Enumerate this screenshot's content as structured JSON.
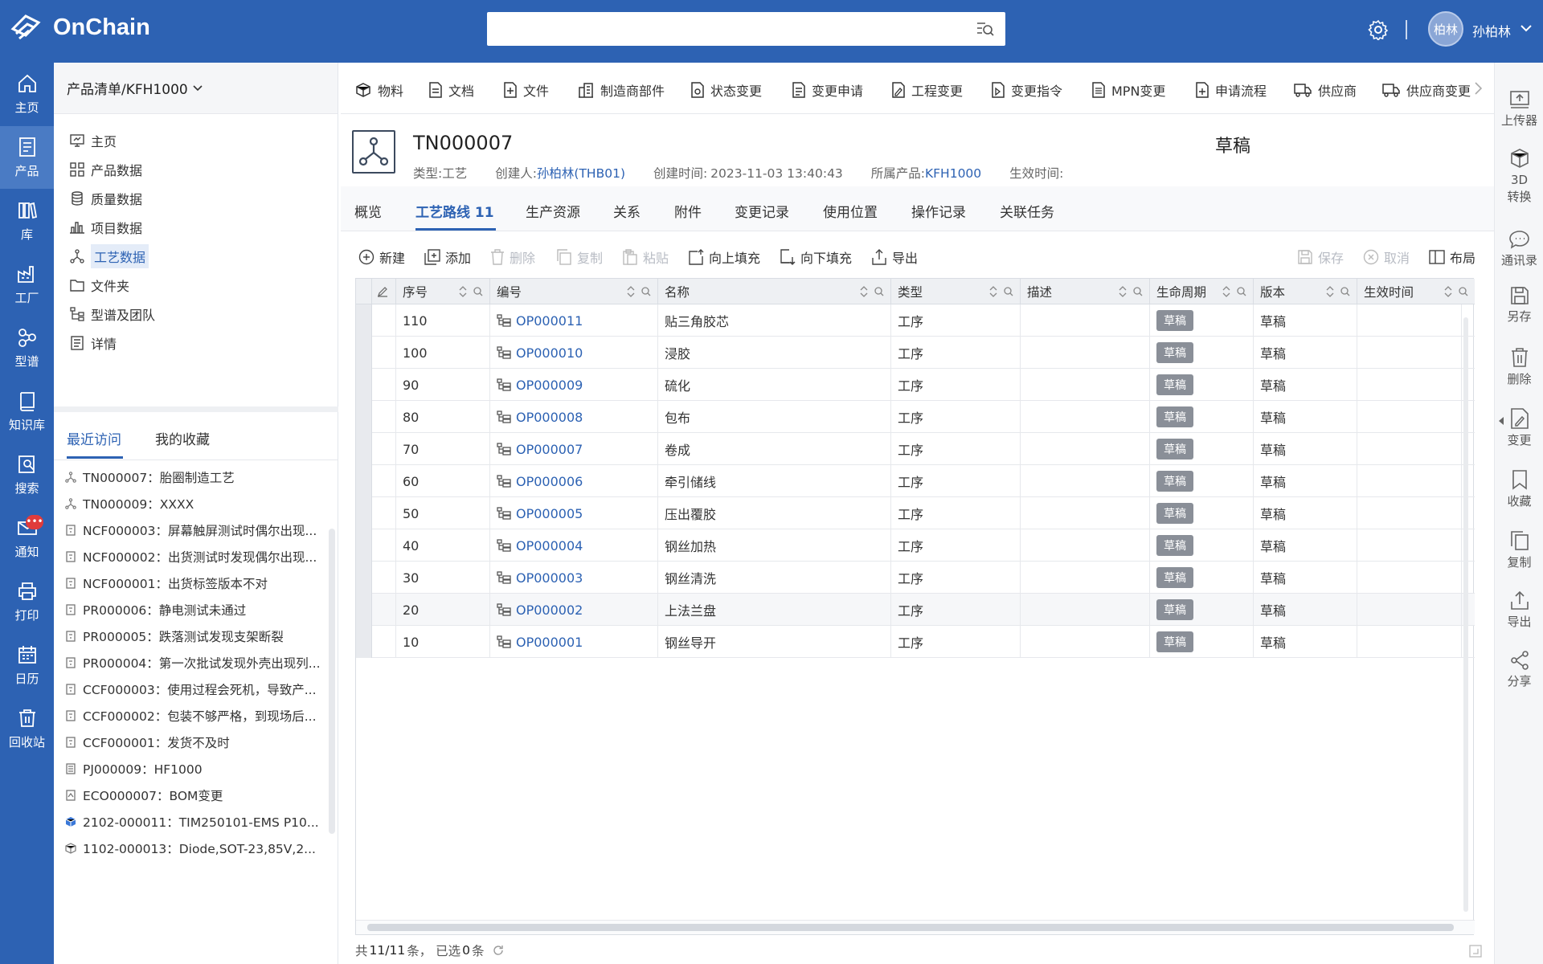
{
  "app": {
    "name": "OnChain"
  },
  "search": {
    "placeholder": ""
  },
  "user": {
    "avatar_text": "柏林",
    "name": "孙柏林"
  },
  "nav": [
    {
      "label": "主页",
      "icon": "home-icon"
    },
    {
      "label": "产品",
      "icon": "product-icon"
    },
    {
      "label": "库",
      "icon": "library-icon"
    },
    {
      "label": "工厂",
      "icon": "factory-icon"
    },
    {
      "label": "型谱",
      "icon": "spectrum-icon"
    },
    {
      "label": "知识库",
      "icon": "knowledge-icon"
    },
    {
      "label": "搜索",
      "icon": "search-icon"
    },
    {
      "label": "通知",
      "icon": "mail-icon",
      "badge": "•••"
    },
    {
      "label": "打印",
      "icon": "print-icon"
    },
    {
      "label": "日历",
      "icon": "calendar-icon"
    },
    {
      "label": "回收站",
      "icon": "trash-icon"
    }
  ],
  "panel": {
    "title": "产品清单/KFH1000",
    "menu": [
      {
        "label": "主页",
        "icon": "monitor-icon"
      },
      {
        "label": "产品数据",
        "icon": "grid-icon"
      },
      {
        "label": "质量数据",
        "icon": "database-icon"
      },
      {
        "label": "项目数据",
        "icon": "bar-chart-icon"
      },
      {
        "label": "工艺数据",
        "icon": "process-icon",
        "active": true
      },
      {
        "label": "文件夹",
        "icon": "folder-icon"
      },
      {
        "label": "型谱及团队",
        "icon": "tree-icon"
      },
      {
        "label": "详情",
        "icon": "detail-icon"
      }
    ],
    "tabs": [
      "最近访问",
      "我的收藏"
    ],
    "recent": [
      {
        "text": "TN000007：胎圈制造工艺",
        "icon": "process-icon"
      },
      {
        "text": "TN000009：XXXX",
        "icon": "process-icon"
      },
      {
        "text": "NCF000003：屏幕触屏测试时偶尔出现...",
        "icon": "doc-icon"
      },
      {
        "text": "NCF000002：出货测试时发现偶尔出现...",
        "icon": "doc-icon"
      },
      {
        "text": "NCF000001：出货标签版本不对",
        "icon": "doc-icon"
      },
      {
        "text": "PR000006：静电测试未通过",
        "icon": "doc-icon"
      },
      {
        "text": "PR000005：跌落测试发现支架断裂",
        "icon": "doc-icon"
      },
      {
        "text": "PR000004：第一次批试发现外壳出现列...",
        "icon": "doc-icon"
      },
      {
        "text": "CCF000003：使用过程会死机，导致产...",
        "icon": "doc-icon"
      },
      {
        "text": "CCF000002：包装不够严格，到现场后...",
        "icon": "doc-icon"
      },
      {
        "text": "CCF000001：发货不及时",
        "icon": "doc-icon"
      },
      {
        "text": "PJ000009：HF1000",
        "icon": "project-icon"
      },
      {
        "text": "ECO000007：BOM变更",
        "icon": "change-icon"
      },
      {
        "text": "2102-000011：TIM250101-EMS P10...",
        "icon": "cube-blue-icon"
      },
      {
        "text": "1102-000013：Diode,SOT-23,85V,2...",
        "icon": "cube-icon"
      }
    ]
  },
  "toolbar": [
    {
      "label": "物料",
      "icon": "cube-icon"
    },
    {
      "label": "文档",
      "icon": "document-icon"
    },
    {
      "label": "文件",
      "icon": "file-icon"
    },
    {
      "label": "制造商部件",
      "icon": "building-icon"
    },
    {
      "label": "状态变更",
      "icon": "status-change-icon"
    },
    {
      "label": "变更申请",
      "icon": "change-request-icon"
    },
    {
      "label": "工程变更",
      "icon": "eng-change-icon"
    },
    {
      "label": "变更指令",
      "icon": "change-order-icon"
    },
    {
      "label": "MPN变更",
      "icon": "mpn-icon"
    },
    {
      "label": "申请流程",
      "icon": "apply-icon"
    },
    {
      "label": "供应商",
      "icon": "supplier-icon"
    },
    {
      "label": "供应商变更",
      "icon": "supplier-change-icon"
    }
  ],
  "object": {
    "id": "TN000007",
    "state": "草稿",
    "type_label": "类型:",
    "type_value": "工艺",
    "creator_label": "创建人:",
    "creator_value": "孙柏林(THB01)",
    "created_label": "创建时间:",
    "created_value": "2023-11-03 13:40:43",
    "product_label": "所属产品:",
    "product_value": "KFH1000",
    "effective_label": "生效时间:",
    "effective_value": ""
  },
  "tabs": [
    "概览",
    "工艺路线 11",
    "生产资源",
    "关系",
    "附件",
    "变更记录",
    "使用位置",
    "操作记录",
    "关联任务"
  ],
  "actions": [
    {
      "label": "新建",
      "icon": "plus-circle-icon",
      "enabled": true
    },
    {
      "label": "添加",
      "icon": "add-icon",
      "enabled": true
    },
    {
      "label": "删除",
      "icon": "delete-icon",
      "enabled": false
    },
    {
      "label": "复制",
      "icon": "copy-icon",
      "enabled": false
    },
    {
      "label": "粘贴",
      "icon": "paste-icon",
      "enabled": false
    },
    {
      "label": "向上填充",
      "icon": "fill-up-icon",
      "enabled": true
    },
    {
      "label": "向下填充",
      "icon": "fill-down-icon",
      "enabled": true
    },
    {
      "label": "导出",
      "icon": "export-icon",
      "enabled": true
    }
  ],
  "actions_right": [
    {
      "label": "保存",
      "icon": "save-icon",
      "enabled": false
    },
    {
      "label": "取消",
      "icon": "cancel-icon",
      "enabled": false
    },
    {
      "label": "布局",
      "icon": "layout-icon",
      "enabled": true
    }
  ],
  "table": {
    "columns": [
      "序号",
      "编号",
      "名称",
      "类型",
      "描述",
      "生命周期",
      "版本",
      "生效时间"
    ],
    "rows": [
      {
        "seq": "110",
        "code": "OP000011",
        "name": "贴三角胶芯",
        "type": "工序",
        "desc": "",
        "life": "草稿",
        "ver": "草稿",
        "eff": ""
      },
      {
        "seq": "100",
        "code": "OP000010",
        "name": "浸胶",
        "type": "工序",
        "desc": "",
        "life": "草稿",
        "ver": "草稿",
        "eff": ""
      },
      {
        "seq": "90",
        "code": "OP000009",
        "name": "硫化",
        "type": "工序",
        "desc": "",
        "life": "草稿",
        "ver": "草稿",
        "eff": ""
      },
      {
        "seq": "80",
        "code": "OP000008",
        "name": "包布",
        "type": "工序",
        "desc": "",
        "life": "草稿",
        "ver": "草稿",
        "eff": ""
      },
      {
        "seq": "70",
        "code": "OP000007",
        "name": "卷成",
        "type": "工序",
        "desc": "",
        "life": "草稿",
        "ver": "草稿",
        "eff": ""
      },
      {
        "seq": "60",
        "code": "OP000006",
        "name": "牵引储线",
        "type": "工序",
        "desc": "",
        "life": "草稿",
        "ver": "草稿",
        "eff": ""
      },
      {
        "seq": "50",
        "code": "OP000005",
        "name": "压出覆胶",
        "type": "工序",
        "desc": "",
        "life": "草稿",
        "ver": "草稿",
        "eff": ""
      },
      {
        "seq": "40",
        "code": "OP000004",
        "name": "钢丝加热",
        "type": "工序",
        "desc": "",
        "life": "草稿",
        "ver": "草稿",
        "eff": ""
      },
      {
        "seq": "30",
        "code": "OP000003",
        "name": "钢丝清洗",
        "type": "工序",
        "desc": "",
        "life": "草稿",
        "ver": "草稿",
        "eff": ""
      },
      {
        "seq": "20",
        "code": "OP000002",
        "name": "上法兰盘",
        "type": "工序",
        "desc": "",
        "life": "草稿",
        "ver": "草稿",
        "eff": ""
      },
      {
        "seq": "10",
        "code": "OP000001",
        "name": "钢丝导开",
        "type": "工序",
        "desc": "",
        "life": "草稿",
        "ver": "草稿",
        "eff": ""
      }
    ]
  },
  "footer": {
    "prefix": "共",
    "total": "11/11",
    "mid": "条， 已选",
    "selected": "0",
    "suffix": "条"
  },
  "right_actions": [
    {
      "label": "上传器",
      "icon": "upload-icon"
    },
    {
      "label": "3D转换",
      "icon": "3d-icon"
    },
    {
      "label": "通讯录",
      "icon": "contacts-icon"
    },
    {
      "label": "另存",
      "icon": "save-as-icon"
    },
    {
      "label": "删除",
      "icon": "trash-icon"
    },
    {
      "label": "变更",
      "icon": "change-icon"
    },
    {
      "label": "收藏",
      "icon": "bookmark-icon"
    },
    {
      "label": "复制",
      "icon": "copy-icon"
    },
    {
      "label": "导出",
      "icon": "export-icon"
    },
    {
      "label": "分享",
      "icon": "share-icon"
    }
  ],
  "colors": {
    "brand": "#2d62b3",
    "link": "#2d62b3",
    "pill": "#8a8f98"
  }
}
